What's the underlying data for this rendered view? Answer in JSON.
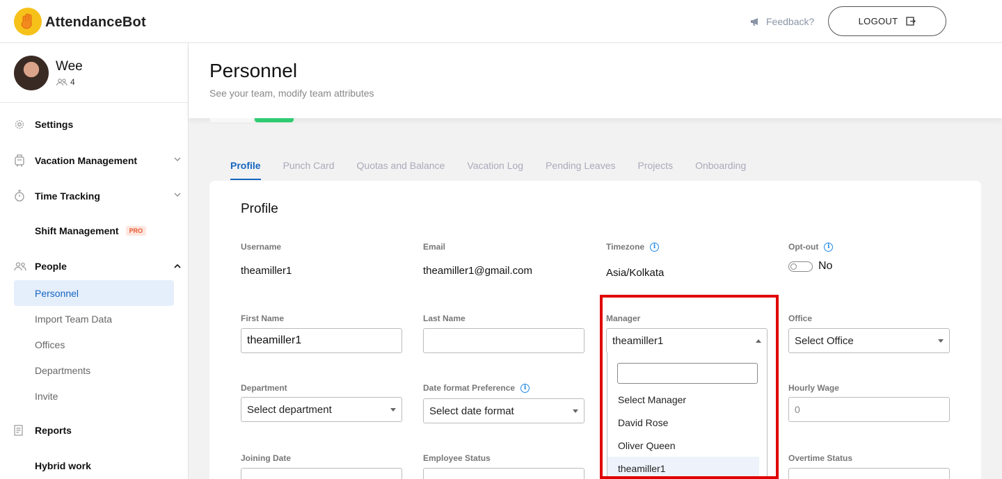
{
  "app": {
    "brand": "AttendanceBot"
  },
  "topbar": {
    "feedback_label": "Feedback?",
    "logout_label": "LOGOUT"
  },
  "user": {
    "name": "Wee",
    "team_count": "4"
  },
  "sidebar": {
    "items": [
      {
        "label": "Settings",
        "icon": "gear-icon"
      },
      {
        "label": "Vacation Management",
        "icon": "suitcase-icon"
      },
      {
        "label": "Time Tracking",
        "icon": "stopwatch-icon"
      },
      {
        "label": "Shift Management",
        "badge": "PRO"
      },
      {
        "label": "People",
        "icon": "people-icon"
      },
      {
        "label": "Reports",
        "icon": "report-icon"
      },
      {
        "label": "Hybrid work"
      }
    ],
    "people_sub": [
      {
        "label": "Personnel",
        "active": true
      },
      {
        "label": "Import Team Data"
      },
      {
        "label": "Offices"
      },
      {
        "label": "Departments"
      },
      {
        "label": "Invite"
      }
    ]
  },
  "page": {
    "title": "Personnel",
    "subtitle": "See your team, modify team attributes"
  },
  "tabs": [
    "Profile",
    "Punch Card",
    "Quotas and Balance",
    "Vacation Log",
    "Pending Leaves",
    "Projects",
    "Onboarding"
  ],
  "profile": {
    "title": "Profile",
    "username": {
      "label": "Username",
      "value": "theamiller1"
    },
    "email": {
      "label": "Email",
      "value": "theamiller1@gmail.com"
    },
    "timezone": {
      "label": "Timezone",
      "value": "Asia/Kolkata"
    },
    "optout": {
      "label": "Opt-out",
      "value": "No"
    },
    "first_name": {
      "label": "First Name",
      "value": "theamiller1"
    },
    "last_name": {
      "label": "Last Name",
      "value": ""
    },
    "manager": {
      "label": "Manager",
      "value": "theamiller1"
    },
    "office": {
      "label": "Office",
      "value": "Select Office"
    },
    "department": {
      "label": "Department",
      "value": "Select department"
    },
    "date_format": {
      "label": "Date format Preference",
      "value": "Select date format"
    },
    "hourly_wage": {
      "label": "Hourly Wage",
      "value": "0"
    },
    "joining_date": {
      "label": "Joining Date"
    },
    "employee_status": {
      "label": "Employee Status"
    },
    "overtime_status": {
      "label": "Overtime Status"
    }
  },
  "manager_dropdown": {
    "options": [
      "Select Manager",
      "David Rose",
      "Oliver Queen",
      "theamiller1"
    ],
    "selected": "theamiller1"
  },
  "colors": {
    "accent": "#1565c0",
    "highlight": "#e00000",
    "logo": "#f6c21a",
    "green": "#2ecc71"
  }
}
